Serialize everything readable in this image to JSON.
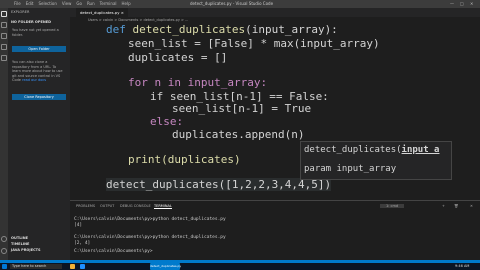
{
  "window": {
    "title": "detect_duplicates.py - Visual Studio Code",
    "menu": [
      "File",
      "Edit",
      "Selection",
      "View",
      "Go",
      "Run",
      "Terminal",
      "Help"
    ]
  },
  "sidebar": {
    "header": "EXPLORER",
    "section": "NO FOLDER OPENED",
    "msg1": "You have not yet opened a folder.",
    "open_button": "Open Folder",
    "msg2": "You can also clone a repository from a URL. To learn more about how to use git and source control in VS Code",
    "link": "read our docs",
    "clone_button": "Clone Repository",
    "outline": "OUTLINE",
    "timeline": "TIMELINE",
    "npm": "JAVA PROJECTS"
  },
  "tabs": [
    {
      "label": "detect_duplicates.py",
      "active": true
    }
  ],
  "breadcrumb": "Users > calvin > Documents > detect_duplicates.py > ...",
  "code": {
    "l1_def": "def",
    "l1_fn": "detect_duplicates",
    "l1_rest": "(input_array):",
    "l2": "seen_list = [False] * max(input_array)",
    "l3": "duplicates = []",
    "l5": "for n in input_array:",
    "l6": "if seen_list[n-1] == False:",
    "l7": "seen_list[n-1] = True",
    "l8": "else:",
    "l9": "duplicates.append(n)",
    "l11": "print(duplicates)",
    "l13": "detect_duplicates([1,2,2,3,4,4,5])"
  },
  "hover": {
    "sig_prefix": "detect_duplicates(",
    "sig_param": "input_a",
    "param": "param input_array"
  },
  "panel": {
    "tabs": [
      "PROBLEMS",
      "OUTPUT",
      "DEBUG CONSOLE",
      "TERMINAL"
    ],
    "terminal_select": "1: cmd",
    "lines": [
      "C:\\Users\\calvin\\Documents\\py>python detect_duplicates.py",
      "[4]",
      "C:\\Users\\calvin\\Documents\\py>python detect_duplicates.py",
      "[2, 4]",
      "C:\\Users\\calvin\\Documents\\py>"
    ]
  },
  "taskbar": {
    "search": "Type here to search",
    "app": "detect_duplicates.py",
    "time": "9:46 AM"
  }
}
